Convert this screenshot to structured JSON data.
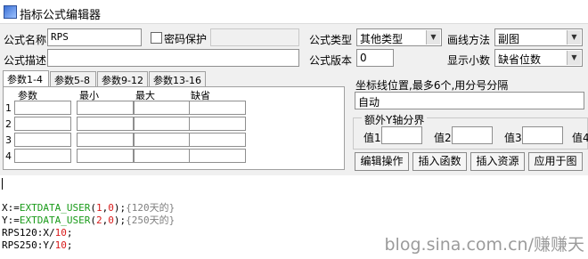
{
  "window": {
    "title": "指标公式编辑器"
  },
  "form": {
    "name_label": "公式名称",
    "name_value": "RPS",
    "password_label": "密码保护",
    "desc_label": "公式描述",
    "desc_value": "",
    "type_label": "公式类型",
    "type_value": "其他类型",
    "draw_label": "画线方法",
    "draw_value": "副图",
    "version_label": "公式版本",
    "version_value": "0",
    "decimal_label": "显示小数",
    "decimal_value": "缺省位数"
  },
  "params": {
    "tabs": [
      "参数1-4",
      "参数5-8",
      "参数9-12",
      "参数13-16"
    ],
    "columns": [
      "参数",
      "最小",
      "最大",
      "缺省"
    ],
    "rows": [
      "1",
      "2",
      "3",
      "4"
    ]
  },
  "axis": {
    "label": "坐标线位置,最多6个,用分号分隔",
    "value": "自动",
    "group_label": "额外Y轴分界",
    "value_labels": [
      "值1",
      "值2",
      "值3",
      "值4"
    ]
  },
  "buttons": {
    "edit": "编辑操作",
    "insert_func": "插入函数",
    "insert_res": "插入资源",
    "apply": "应用于图"
  },
  "code": {
    "line1": {
      "head": "X:=",
      "func": "EXTDATA_USER",
      "open": "(",
      "a": "1",
      "comma": ",",
      "b": "0",
      "close": ");",
      "comment": "{120天的}"
    },
    "line2": {
      "head": "Y:=",
      "func": "EXTDATA_USER",
      "open": "(",
      "a": "2",
      "comma": ",",
      "b": "0",
      "close": ");",
      "comment": "{250天的}"
    },
    "line3": {
      "head": "RPS120:X/",
      "num": "10",
      "tail": ";"
    },
    "line4": {
      "head": "RPS250:Y/",
      "num": "10",
      "tail": ";"
    }
  },
  "watermark": "blog.sina.com.cn/",
  "watermark_logo": "赚赚天"
}
